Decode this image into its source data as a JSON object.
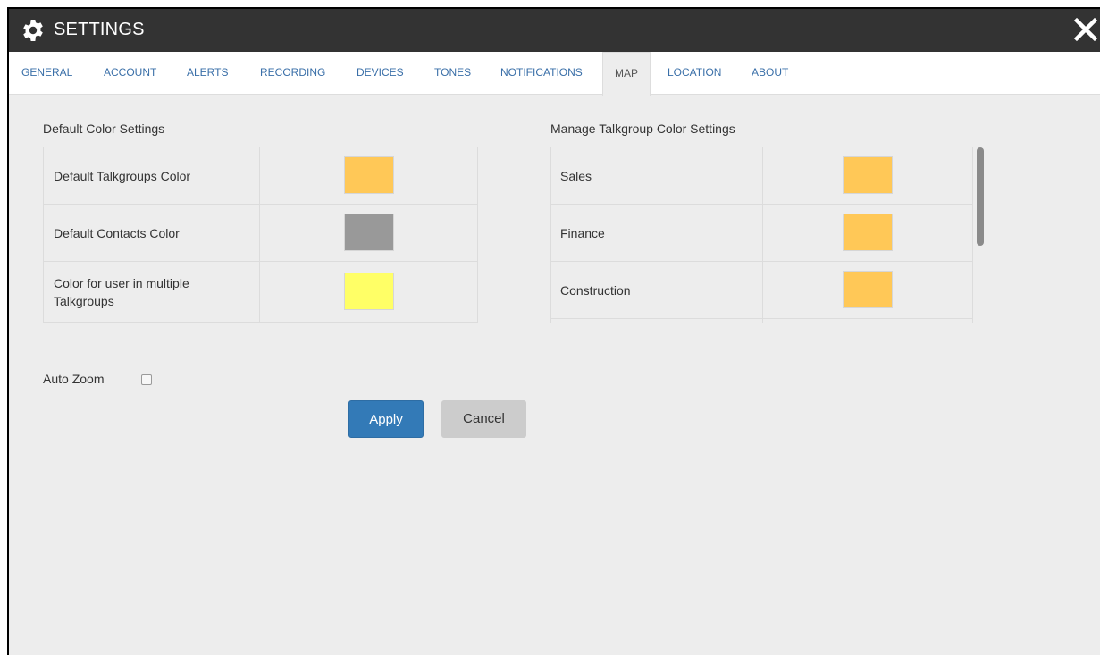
{
  "window": {
    "title": "SETTINGS"
  },
  "icons": {
    "settings": "gear-icon",
    "close": "close-icon"
  },
  "tabs": [
    {
      "label": "GENERAL"
    },
    {
      "label": "ACCOUNT"
    },
    {
      "label": "ALERTS"
    },
    {
      "label": "RECORDING"
    },
    {
      "label": "DEVICES"
    },
    {
      "label": "TONES"
    },
    {
      "label": "NOTIFICATIONS"
    },
    {
      "label": "MAP",
      "active": true
    },
    {
      "label": "LOCATION"
    },
    {
      "label": "ABOUT"
    }
  ],
  "default_colors": {
    "title": "Default Color Settings",
    "rows": [
      {
        "label": "Default Talkgroups Color",
        "color": "#ffc857"
      },
      {
        "label": "Default Contacts Color",
        "color": "#999999"
      },
      {
        "label": "Color for user in multiple Talkgroups",
        "color": "#ffff66"
      }
    ]
  },
  "talkgroup_colors": {
    "title": "Manage Talkgroup Color Settings",
    "rows": [
      {
        "label": "Sales",
        "color": "#ffc857"
      },
      {
        "label": "Finance",
        "color": "#ffc857"
      },
      {
        "label": "Construction",
        "color": "#ffc857"
      }
    ]
  },
  "auto_zoom": {
    "label": "Auto Zoom",
    "checked": false
  },
  "buttons": {
    "apply": "Apply",
    "cancel": "Cancel"
  },
  "colors": {
    "titlebar": "#333333",
    "accent": "#337ab7",
    "tab_link": "#3a6fa8"
  }
}
